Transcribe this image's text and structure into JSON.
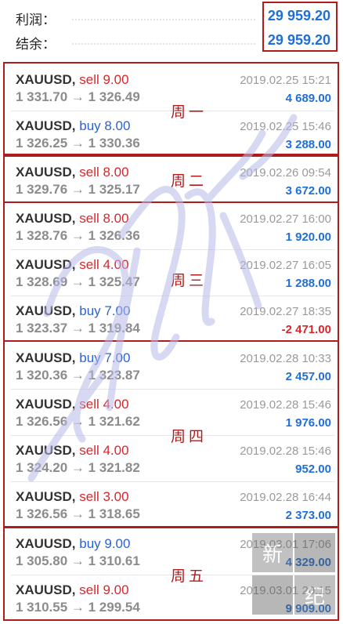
{
  "summary": [
    {
      "label": "利润：",
      "value": "29 959.20"
    },
    {
      "label": "结余：",
      "value": "29 959.20"
    }
  ],
  "trades": [
    {
      "symbol": "XAUUSD,",
      "side": "sell",
      "lots": "sell 9.00",
      "prices": "1 331.70 → 1 326.49",
      "time": "2019.02.25 15:21",
      "profit": "4 689.00"
    },
    {
      "symbol": "XAUUSD,",
      "side": "buy",
      "lots": "buy 8.00",
      "prices": "1 326.25 → 1 330.36",
      "time": "2019.02.25 15:46",
      "profit": "3 288.00"
    },
    {
      "symbol": "XAUUSD,",
      "side": "sell",
      "lots": "sell 8.00",
      "prices": "1 329.76 → 1 325.17",
      "time": "2019.02.26 09:54",
      "profit": "3 672.00"
    },
    {
      "symbol": "XAUUSD,",
      "side": "sell",
      "lots": "sell 8.00",
      "prices": "1 328.76 → 1 326.36",
      "time": "2019.02.27 16:00",
      "profit": "1 920.00"
    },
    {
      "symbol": "XAUUSD,",
      "side": "sell",
      "lots": "sell 4.00",
      "prices": "1 328.69 → 1 325.47",
      "time": "2019.02.27 16:05",
      "profit": "1 288.00"
    },
    {
      "symbol": "XAUUSD,",
      "side": "buy",
      "lots": "buy 7.00",
      "prices": "1 323.37 → 1 319.84",
      "time": "2019.02.27 18:35",
      "profit": "-2 471.00"
    },
    {
      "symbol": "XAUUSD,",
      "side": "buy",
      "lots": "buy 7.00",
      "prices": "1 320.36 → 1 323.87",
      "time": "2019.02.28 10:33",
      "profit": "2 457.00"
    },
    {
      "symbol": "XAUUSD,",
      "side": "sell",
      "lots": "sell 4.00",
      "prices": "1 326.56 → 1 321.62",
      "time": "2019.02.28 15:46",
      "profit": "1 976.00"
    },
    {
      "symbol": "XAUUSD,",
      "side": "sell",
      "lots": "sell 4.00",
      "prices": "1 324.20 → 1 321.82",
      "time": "2019.02.28 15:46",
      "profit": "952.00"
    },
    {
      "symbol": "XAUUSD,",
      "side": "sell",
      "lots": "sell 3.00",
      "prices": "1 326.56 → 1 318.65",
      "time": "2019.02.28 16:44",
      "profit": "2 373.00"
    },
    {
      "symbol": "XAUUSD,",
      "side": "buy",
      "lots": "buy 9.00",
      "prices": "1 305.80 → 1 310.61",
      "time": "2019.03.01 17:06",
      "profit": "4 329.00"
    },
    {
      "symbol": "XAUUSD,",
      "side": "sell",
      "lots": "sell 9.00",
      "prices": "1 310.55 → 1 299.54",
      "time": "2019.03.01 20:15",
      "profit": "9 909.00"
    }
  ],
  "day_labels": [
    "周一",
    "周二",
    "周三",
    "周四",
    "周五"
  ],
  "stamp_chars": [
    "新",
    "",
    "纪",
    ""
  ],
  "colors": {
    "accent_red": "#b01c1c",
    "sell": "#d8262b",
    "buy": "#2a63d3",
    "profit": "#1f6fd6"
  }
}
